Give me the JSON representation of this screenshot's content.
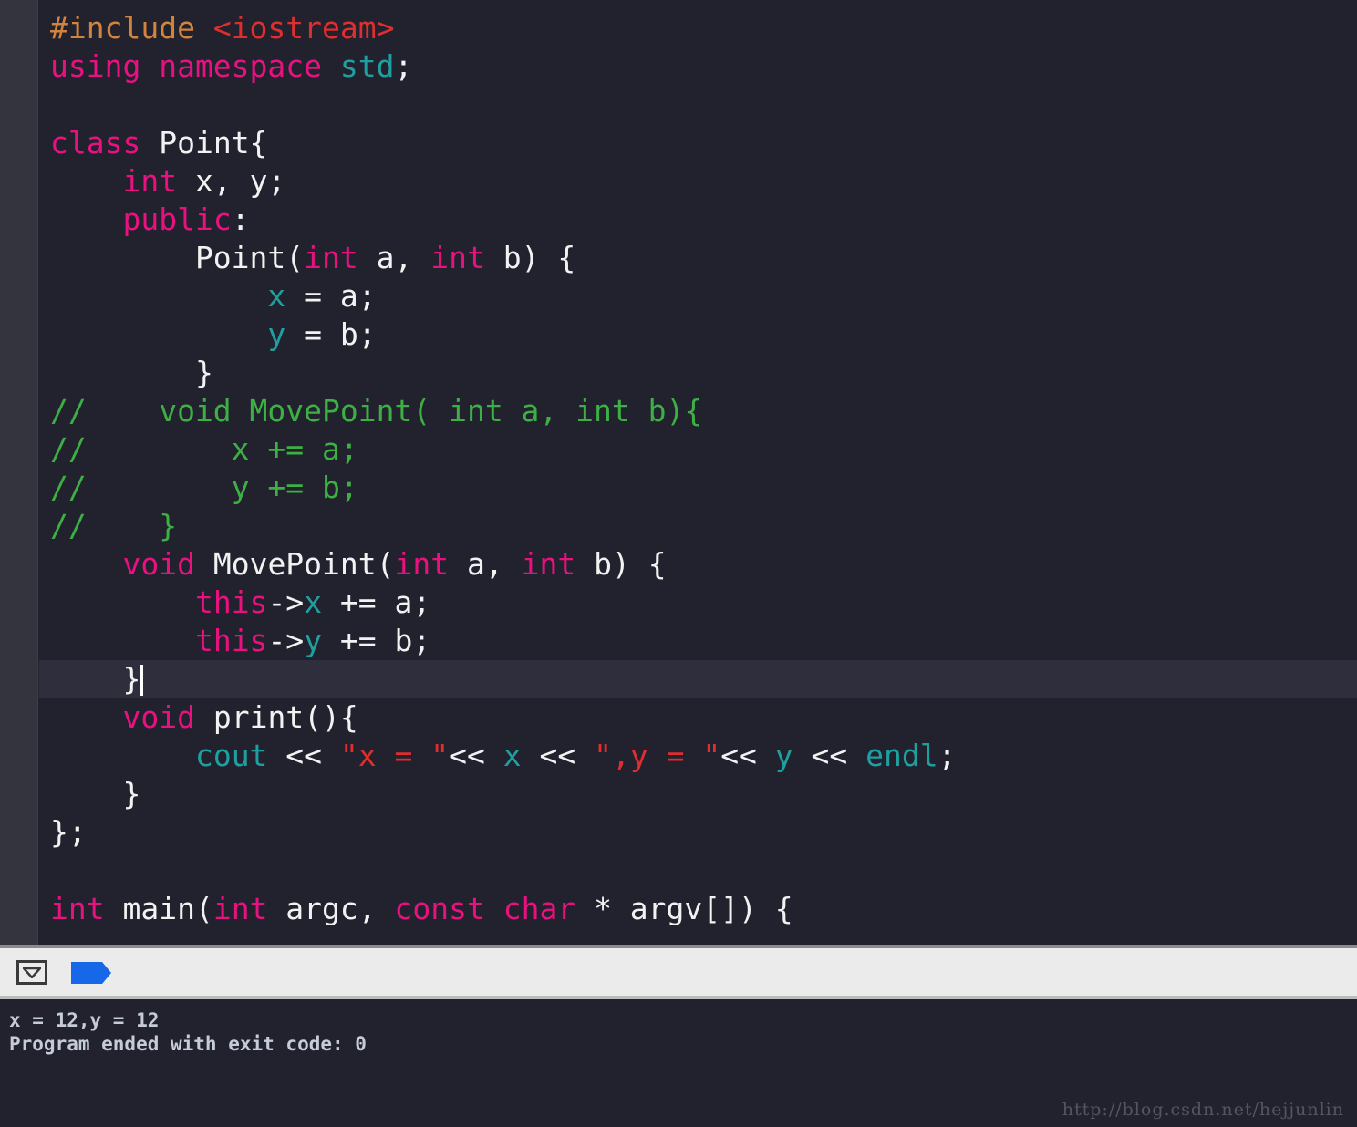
{
  "editor": {
    "language": "C++",
    "background_color": "#22222e",
    "gutter_color": "#34343f",
    "active_line_color": "#2e2e3c",
    "active_line_index": 17,
    "cursor_line_text": "    }",
    "syntax_colors": {
      "preprocessor": "#d2833c",
      "header": "#e02e2e",
      "keyword": "#e8117f",
      "identifier": "#1fa0a0",
      "comment": "#3cb043",
      "string": "#e02e2e",
      "plain": "#f2f2f2"
    },
    "lines": [
      {
        "i": 0,
        "tokens": [
          {
            "t": "#include ",
            "c": "pre"
          },
          {
            "t": "<iostream>",
            "c": "hdr"
          }
        ]
      },
      {
        "i": 1,
        "tokens": [
          {
            "t": "using namespace ",
            "c": "kw"
          },
          {
            "t": "std",
            "c": "ident"
          },
          {
            "t": ";",
            "c": "plain"
          }
        ]
      },
      {
        "i": 2,
        "tokens": []
      },
      {
        "i": 3,
        "tokens": [
          {
            "t": "class ",
            "c": "kw"
          },
          {
            "t": "Point{",
            "c": "plain"
          }
        ]
      },
      {
        "i": 4,
        "tokens": [
          {
            "t": "    ",
            "c": "plain"
          },
          {
            "t": "int",
            "c": "type"
          },
          {
            "t": " x, y;",
            "c": "plain"
          }
        ]
      },
      {
        "i": 5,
        "tokens": [
          {
            "t": "    ",
            "c": "plain"
          },
          {
            "t": "public",
            "c": "kw"
          },
          {
            "t": ":",
            "c": "plain"
          }
        ]
      },
      {
        "i": 6,
        "tokens": [
          {
            "t": "        Point(",
            "c": "plain"
          },
          {
            "t": "int",
            "c": "type"
          },
          {
            "t": " a, ",
            "c": "plain"
          },
          {
            "t": "int",
            "c": "type"
          },
          {
            "t": " b) {",
            "c": "plain"
          }
        ]
      },
      {
        "i": 7,
        "tokens": [
          {
            "t": "            ",
            "c": "plain"
          },
          {
            "t": "x",
            "c": "ident"
          },
          {
            "t": " = a;",
            "c": "plain"
          }
        ]
      },
      {
        "i": 8,
        "tokens": [
          {
            "t": "            ",
            "c": "plain"
          },
          {
            "t": "y",
            "c": "ident"
          },
          {
            "t": " = b;",
            "c": "plain"
          }
        ]
      },
      {
        "i": 9,
        "tokens": [
          {
            "t": "        }",
            "c": "plain"
          }
        ]
      },
      {
        "i": 10,
        "tokens": [
          {
            "t": "//    void MovePoint( int a, int b){",
            "c": "cmt"
          }
        ]
      },
      {
        "i": 11,
        "tokens": [
          {
            "t": "//        x += a;",
            "c": "cmt"
          }
        ]
      },
      {
        "i": 12,
        "tokens": [
          {
            "t": "//        y += b;",
            "c": "cmt"
          }
        ]
      },
      {
        "i": 13,
        "tokens": [
          {
            "t": "//    }",
            "c": "cmt"
          }
        ]
      },
      {
        "i": 14,
        "tokens": [
          {
            "t": "    ",
            "c": "plain"
          },
          {
            "t": "void",
            "c": "kw"
          },
          {
            "t": " MovePoint(",
            "c": "plain"
          },
          {
            "t": "int",
            "c": "type"
          },
          {
            "t": " a, ",
            "c": "plain"
          },
          {
            "t": "int",
            "c": "type"
          },
          {
            "t": " b) {",
            "c": "plain"
          }
        ]
      },
      {
        "i": 15,
        "tokens": [
          {
            "t": "        ",
            "c": "plain"
          },
          {
            "t": "this",
            "c": "kw"
          },
          {
            "t": "->",
            "c": "plain"
          },
          {
            "t": "x",
            "c": "ident"
          },
          {
            "t": " += a;",
            "c": "plain"
          }
        ]
      },
      {
        "i": 16,
        "tokens": [
          {
            "t": "        ",
            "c": "plain"
          },
          {
            "t": "this",
            "c": "kw"
          },
          {
            "t": "->",
            "c": "plain"
          },
          {
            "t": "y",
            "c": "ident"
          },
          {
            "t": " += b;",
            "c": "plain"
          }
        ]
      },
      {
        "i": 17,
        "tokens": [
          {
            "t": "    }",
            "c": "plain"
          }
        ],
        "active": true,
        "caret": true
      },
      {
        "i": 18,
        "tokens": [
          {
            "t": "    ",
            "c": "plain"
          },
          {
            "t": "void",
            "c": "kw"
          },
          {
            "t": " print(){",
            "c": "plain"
          }
        ]
      },
      {
        "i": 19,
        "tokens": [
          {
            "t": "        ",
            "c": "plain"
          },
          {
            "t": "cout",
            "c": "ident"
          },
          {
            "t": " << ",
            "c": "plain"
          },
          {
            "t": "\"x = \"",
            "c": "str"
          },
          {
            "t": "<< ",
            "c": "plain"
          },
          {
            "t": "x",
            "c": "ident"
          },
          {
            "t": " << ",
            "c": "plain"
          },
          {
            "t": "\",y = \"",
            "c": "str"
          },
          {
            "t": "<< ",
            "c": "plain"
          },
          {
            "t": "y",
            "c": "ident"
          },
          {
            "t": " << ",
            "c": "plain"
          },
          {
            "t": "endl",
            "c": "ident"
          },
          {
            "t": ";",
            "c": "plain"
          }
        ]
      },
      {
        "i": 20,
        "tokens": [
          {
            "t": "    }",
            "c": "plain"
          }
        ]
      },
      {
        "i": 21,
        "tokens": [
          {
            "t": "};",
            "c": "plain"
          }
        ]
      },
      {
        "i": 22,
        "tokens": []
      },
      {
        "i": 23,
        "tokens": [
          {
            "t": "int",
            "c": "type"
          },
          {
            "t": " main(",
            "c": "plain"
          },
          {
            "t": "int",
            "c": "type"
          },
          {
            "t": " argc, ",
            "c": "plain"
          },
          {
            "t": "const char",
            "c": "type"
          },
          {
            "t": " * argv[]) {",
            "c": "plain"
          }
        ]
      }
    ]
  },
  "toolbar": {
    "background_color": "#ebebeb",
    "hide_console_label": "",
    "flag_color": "#1668e8",
    "buttons": [
      {
        "name": "show-hide-debug-area",
        "icon": "chevron-down-box-icon"
      },
      {
        "name": "breakpoints-toggle",
        "icon": "breakpoint-flag-icon"
      }
    ]
  },
  "console": {
    "background_color": "#22222e",
    "text_color": "#c5cbd8",
    "lines": [
      "x = 12,y = 12",
      "Program ended with exit code: 0"
    ]
  },
  "watermark": {
    "text": "http://blog.csdn.net/hejjunlin"
  }
}
